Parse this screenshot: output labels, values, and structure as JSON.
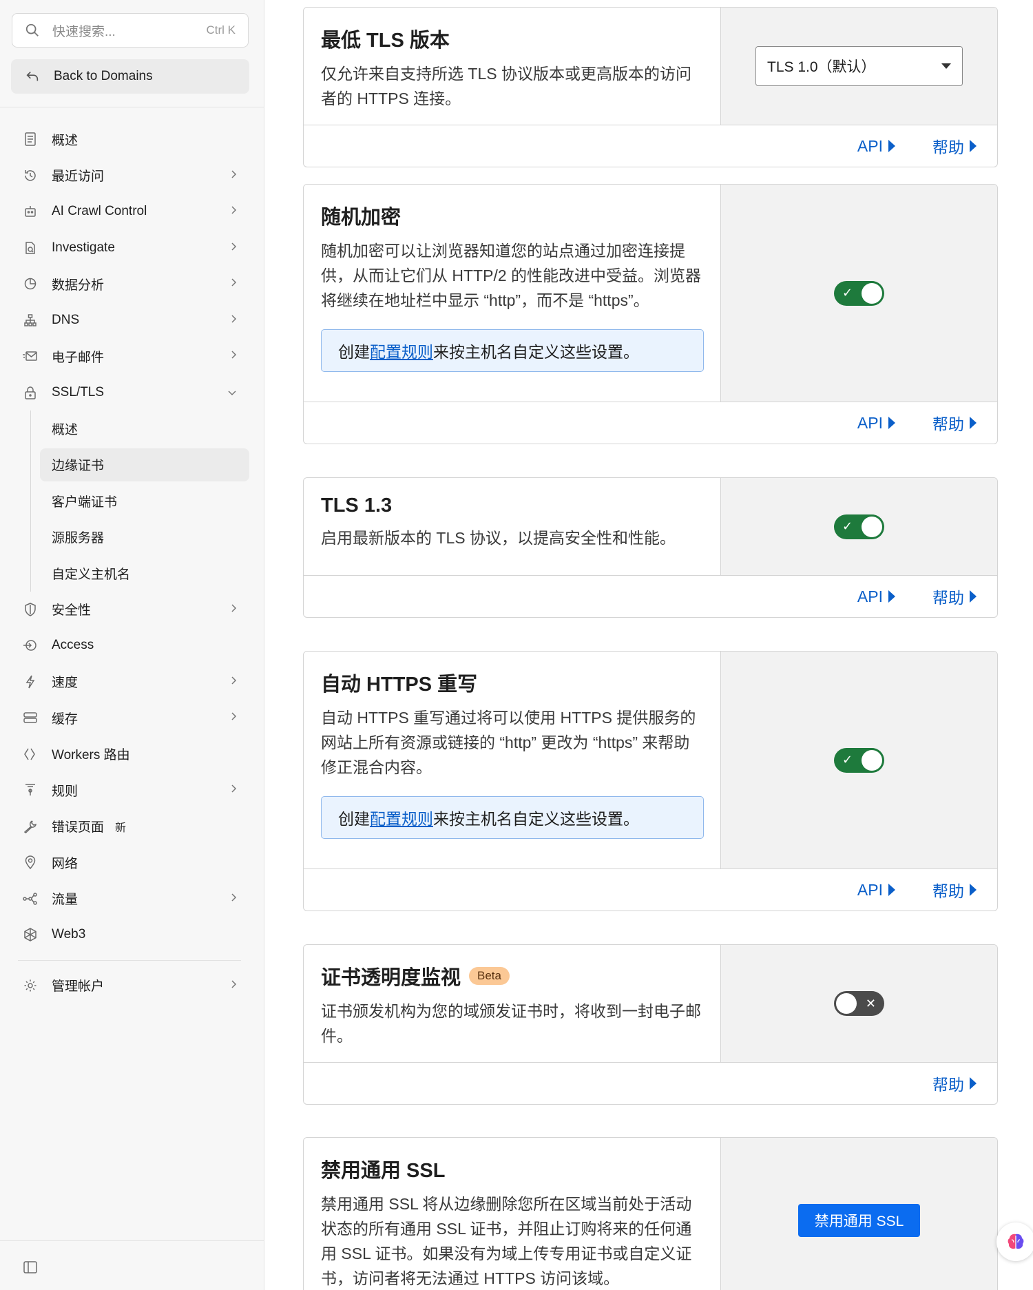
{
  "sidebar": {
    "search": {
      "placeholder": "快速搜索...",
      "shortcut": "Ctrl K"
    },
    "back_label": "Back to Domains",
    "items": [
      {
        "label": "概述",
        "icon": "document-icon",
        "chevron": false
      },
      {
        "label": "最近访问",
        "icon": "history-icon",
        "chevron": true
      },
      {
        "label": "AI Crawl Control",
        "icon": "robot-icon",
        "chevron": true
      },
      {
        "label": "Investigate",
        "icon": "investigate-icon",
        "chevron": true
      },
      {
        "label": "数据分析",
        "icon": "pie-chart-icon",
        "chevron": true
      },
      {
        "label": "DNS",
        "icon": "network-tree-icon",
        "chevron": true
      },
      {
        "label": "电子邮件",
        "icon": "email-icon",
        "chevron": true
      },
      {
        "label": "SSL/TLS",
        "icon": "lock-icon",
        "chevron": "down"
      }
    ],
    "ssl_sub": [
      "概述",
      "边缘证书",
      "客户端证书",
      "源服务器",
      "自定义主机名"
    ],
    "ssl_active": "边缘证书",
    "items2": [
      {
        "label": "安全性",
        "icon": "shield-icon",
        "chevron": true
      },
      {
        "label": "Access",
        "icon": "access-icon",
        "chevron": false
      },
      {
        "label": "速度",
        "icon": "lightning-icon",
        "chevron": true
      },
      {
        "label": "缓存",
        "icon": "cache-icon",
        "chevron": true
      },
      {
        "label": "Workers 路由",
        "icon": "workers-icon",
        "chevron": false
      },
      {
        "label": "规则",
        "icon": "rules-icon",
        "chevron": true
      },
      {
        "label": "错误页面",
        "icon": "wrench-icon",
        "chevron": false,
        "badge": "新"
      },
      {
        "label": "网络",
        "icon": "location-icon",
        "chevron": false
      },
      {
        "label": "流量",
        "icon": "traffic-icon",
        "chevron": true
      },
      {
        "label": "Web3",
        "icon": "web3-icon",
        "chevron": false
      }
    ],
    "manage_account": "管理帐户"
  },
  "cards": {
    "min_tls": {
      "title": "最低 TLS 版本",
      "desc": "仅允许来自支持所选 TLS 协议版本或更高版本的访问者的 HTTPS 连接。",
      "select_value": "TLS 1.0（默认）"
    },
    "opportunistic": {
      "title": "随机加密",
      "desc": "随机加密可以让浏览器知道您的站点通过加密连接提供，从而让它们从 HTTP/2 的性能改进中受益。浏览器将继续在地址栏中显示 “http”，而不是 “https”。",
      "info_prefix": "创建",
      "info_link": "配置规则",
      "info_suffix": "来按主机名自定义这些设置。",
      "enabled": true
    },
    "tls13": {
      "title": "TLS 1.3",
      "desc": "启用最新版本的 TLS 协议，以提高安全性和性能。",
      "enabled": true
    },
    "auto_https": {
      "title": "自动 HTTPS 重写",
      "desc": "自动 HTTPS 重写通过将可以使用 HTTPS 提供服务的网站上所有资源或链接的 “http” 更改为 “https” 来帮助修正混合内容。",
      "info_prefix": "创建",
      "info_link": "配置规则",
      "info_suffix": "来按主机名自定义这些设置。",
      "enabled": true
    },
    "ct_monitor": {
      "title": "证书透明度监视",
      "badge": "Beta",
      "desc": "证书颁发机构为您的域颁发证书时，将收到一封电子邮件。",
      "enabled": false
    },
    "disable_ssl": {
      "title": "禁用通用 SSL",
      "desc": "禁用通用 SSL 将从边缘删除您所在区域当前处于活动状态的所有通用 SSL 证书，并阻止订购将来的任何通用 SSL 证书。如果没有为域上传专用证书或自定义证书，访问者将无法通过 HTTPS 访问该域。",
      "button": "禁用通用 SSL"
    }
  },
  "links": {
    "api": "API",
    "help": "帮助"
  },
  "colors": {
    "toggle_on": "#1e7a3c",
    "toggle_off": "#4b4b4b",
    "link": "#0b5fc9",
    "primary_button": "#0b6cf0",
    "beta_badge": "#fbc895"
  }
}
